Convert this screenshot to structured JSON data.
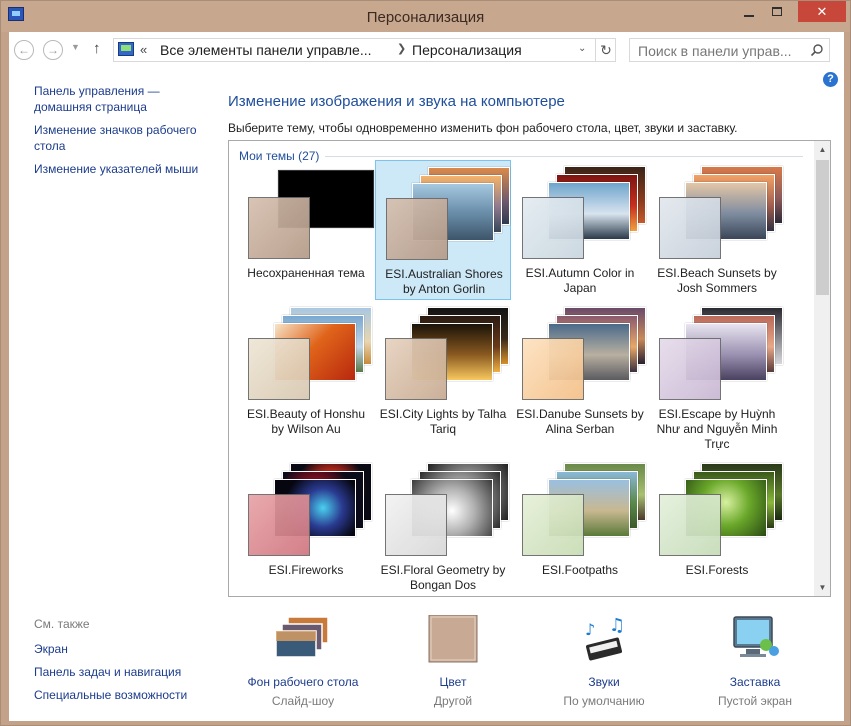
{
  "window": {
    "title": "Персонализация"
  },
  "address_bar": {
    "chevron": "«",
    "crumbs": [
      "Все элементы панели управле...",
      "Персонализация"
    ],
    "search_placeholder": "Поиск в панели управ..."
  },
  "sidebar": {
    "links": [
      "Панель управления — домашняя страница",
      "Изменение значков рабочего стола",
      "Изменение указателей мыши"
    ]
  },
  "see_also": {
    "heading": "См. также",
    "links": [
      "Экран",
      "Панель задач и навигация",
      "Специальные возможности"
    ]
  },
  "main": {
    "title": "Изменение изображения и звука на компьютере",
    "description": "Выберите тему, чтобы одновременно изменить фон рабочего стола, цвет, звуки и заставку.",
    "group_heading": "Мои темы (27)"
  },
  "themes": [
    {
      "label": "Несохраненная тема",
      "selected": false
    },
    {
      "label": "ESI.Australian Shores by Anton Gorlin",
      "selected": true
    },
    {
      "label": "ESI.Autumn Color in Japan",
      "selected": false
    },
    {
      "label": "ESI.Beach Sunsets by Josh Sommers",
      "selected": false
    },
    {
      "label": "ESI.Beauty of Honshu by Wilson Au",
      "selected": false
    },
    {
      "label": "ESI.City Lights by Talha Tariq",
      "selected": false
    },
    {
      "label": "ESI.Danube Sunsets by Alina Serban",
      "selected": false
    },
    {
      "label": "ESI.Escape by Huỳnh Như and Nguyễn Minh Trực",
      "selected": false
    },
    {
      "label": "ESI.Fireworks",
      "selected": false
    },
    {
      "label": "ESI.Floral Geometry by Bongan Dos",
      "selected": false
    },
    {
      "label": "ESI.Footpaths",
      "selected": false
    },
    {
      "label": "ESI.Forests",
      "selected": false
    }
  ],
  "bottom_bar": [
    {
      "title": "Фон рабочего стола",
      "subtitle": "Слайд-шоу",
      "icon": "desktop-background-icon"
    },
    {
      "title": "Цвет",
      "subtitle": "Другой",
      "icon": "color-icon"
    },
    {
      "title": "Звуки",
      "subtitle": "По умолчанию",
      "icon": "sounds-icon"
    },
    {
      "title": "Заставка",
      "subtitle": "Пустой экран",
      "icon": "screensaver-icon"
    }
  ],
  "colors": {
    "title_bar": "#c8a78f",
    "close_button": "#c7473a",
    "link": "#1c3c8c",
    "heading": "#1f4e9b",
    "selection_fill": "#cde8f7",
    "selection_border": "#7ec4ea"
  }
}
